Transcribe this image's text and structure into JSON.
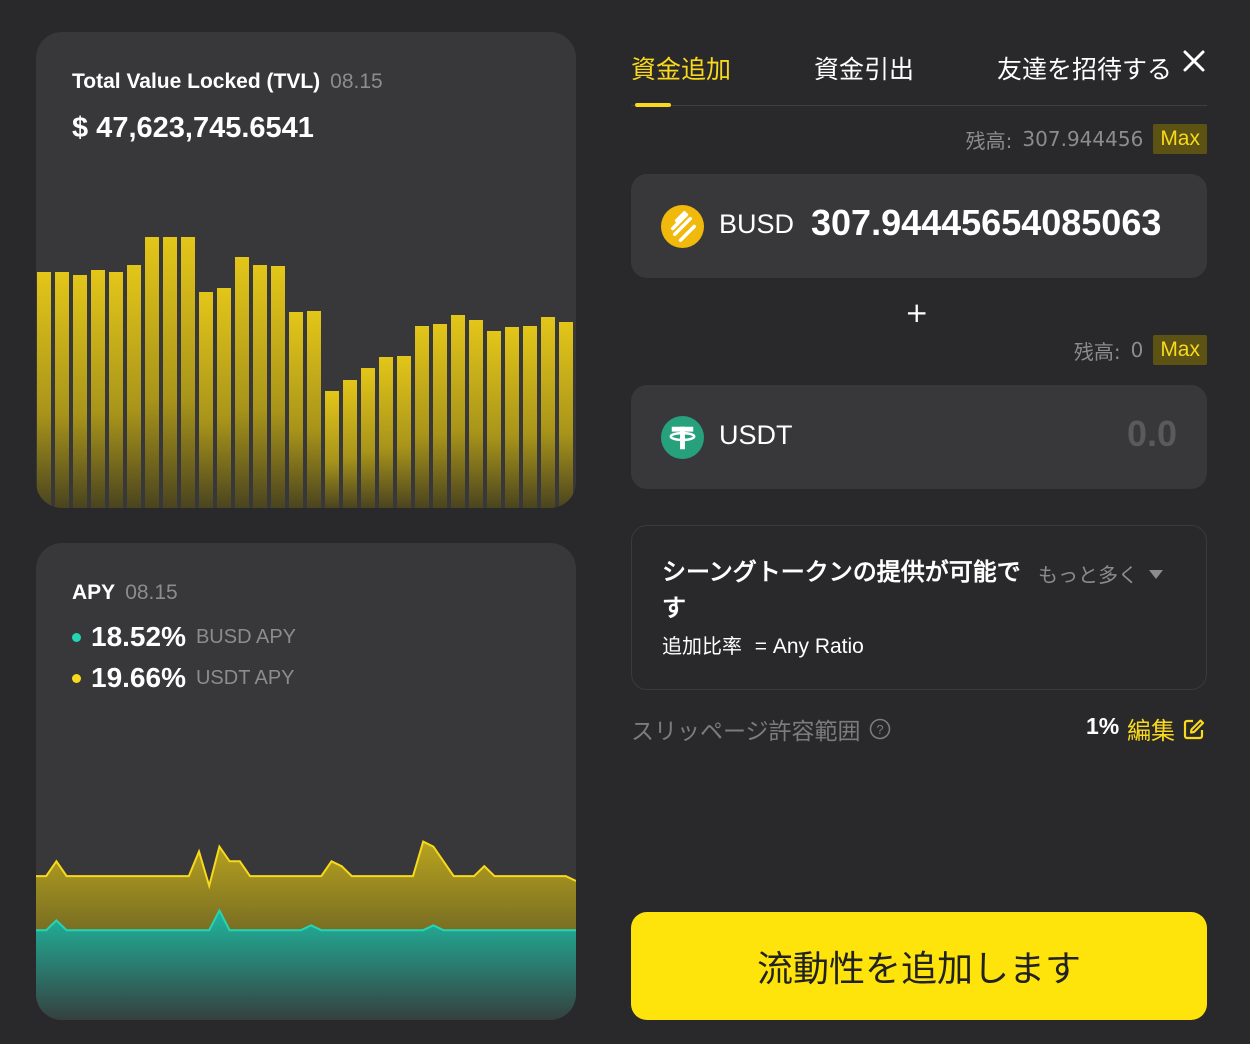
{
  "colors": {
    "background": "#29292b",
    "card": "#38383a",
    "accent_yellow": "#f9d91c",
    "teal": "#22d6b5",
    "muted_text": "#8c8c8e",
    "button_yellow": "#ffe40b"
  },
  "tvl": {
    "title": "Total Value Locked (TVL)",
    "date": "08.15",
    "value": "$ 47,623,745.6541"
  },
  "apy": {
    "title": "APY",
    "date": "08.15",
    "rows": [
      {
        "dot_color": "#22d6b5",
        "value": "18.52%",
        "label": "BUSD APY"
      },
      {
        "dot_color": "#f9d91c",
        "value": "19.66%",
        "label": "USDT  APY"
      }
    ]
  },
  "chart_data": [
    {
      "type": "bar",
      "title": "Total Value Locked (TVL)",
      "values": [
        236,
        236,
        233,
        238,
        236,
        243,
        271,
        271,
        271,
        216,
        220,
        251,
        243,
        242,
        196,
        197,
        117,
        128,
        140,
        151,
        152,
        182,
        184,
        193,
        188,
        177,
        181,
        182,
        191,
        186
      ],
      "ylim": [
        0,
        300
      ],
      "grid": false
    },
    {
      "type": "area",
      "title": "APY",
      "series": [
        {
          "name": "USDT  APY",
          "color": "#f9d91c",
          "values": [
            19.6,
            19.6,
            19.9,
            19.6,
            19.6,
            19.6,
            19.6,
            19.6,
            19.6,
            19.6,
            19.6,
            19.6,
            19.6,
            19.6,
            19.6,
            19.6,
            20.1,
            19.4,
            20.2,
            19.9,
            19.9,
            19.6,
            19.6,
            19.6,
            19.6,
            19.6,
            19.6,
            19.6,
            19.6,
            19.9,
            19.8,
            19.6,
            19.6,
            19.6,
            19.6,
            19.6,
            19.6,
            19.6,
            20.3,
            20.2,
            19.9,
            19.6,
            19.6,
            19.6,
            19.8,
            19.6,
            19.6,
            19.6,
            19.6,
            19.6,
            19.6,
            19.6,
            19.6,
            19.5
          ]
        },
        {
          "name": "BUSD APY",
          "color": "#22d6b5",
          "values": [
            18.5,
            18.5,
            18.7,
            18.5,
            18.5,
            18.5,
            18.5,
            18.5,
            18.5,
            18.5,
            18.5,
            18.5,
            18.5,
            18.5,
            18.5,
            18.5,
            18.5,
            18.5,
            18.9,
            18.5,
            18.5,
            18.5,
            18.5,
            18.5,
            18.5,
            18.5,
            18.5,
            18.6,
            18.5,
            18.5,
            18.5,
            18.5,
            18.5,
            18.5,
            18.5,
            18.5,
            18.5,
            18.5,
            18.5,
            18.6,
            18.5,
            18.5,
            18.5,
            18.5,
            18.5,
            18.5,
            18.5,
            18.5,
            18.5,
            18.5,
            18.5,
            18.5,
            18.5,
            18.5
          ]
        }
      ],
      "ylim": [
        17,
        22
      ]
    }
  ],
  "tabs": [
    {
      "label": "資金追加",
      "active": true
    },
    {
      "label": "資金引出",
      "active": false
    },
    {
      "label": "友達を招待する",
      "active": false
    }
  ],
  "token1": {
    "balance_label": "残高:",
    "balance": "307.944456",
    "max_label": "Max",
    "symbol": "BUSD",
    "icon": "busd-icon",
    "amount": "307.94445654085063"
  },
  "plus": "+",
  "token2": {
    "balance_label": "残高:",
    "balance": "0",
    "max_label": "Max",
    "symbol": "USDT",
    "icon": "usdt-icon",
    "placeholder": "0.0"
  },
  "info": {
    "title": "シーングトークンの提供が可能です",
    "more_label": "もっと多く",
    "ratio_label": "追加比率",
    "ratio_value": "= Any Ratio"
  },
  "slippage": {
    "label": "スリッページ許容範囲",
    "value": "1%",
    "edit_label": "編集"
  },
  "submit_label": "流動性を追加します"
}
